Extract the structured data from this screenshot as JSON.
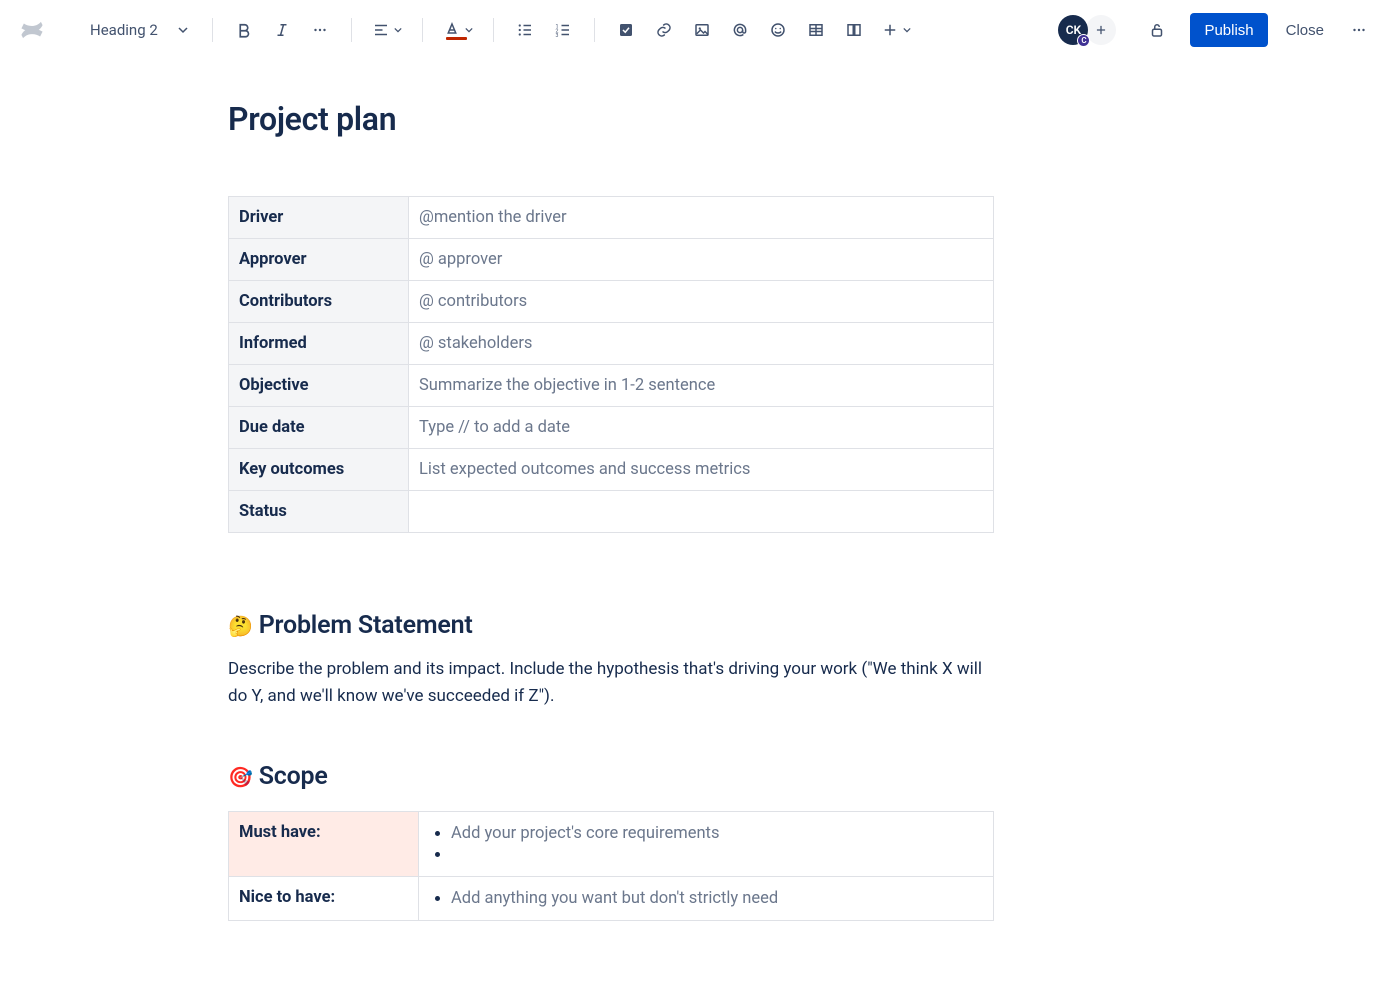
{
  "toolbar": {
    "heading_label": "Heading 2",
    "publish_label": "Publish",
    "close_label": "Close",
    "avatar_initials": "CK",
    "presence_initial": "C",
    "accent_color": "#0052CC"
  },
  "document": {
    "title": "Project plan",
    "meta_rows": [
      {
        "label": "Driver",
        "value": "@mention the driver"
      },
      {
        "label": "Approver",
        "value": "@ approver"
      },
      {
        "label": "Contributors",
        "value": "@ contributors"
      },
      {
        "label": "Informed",
        "value": "@ stakeholders"
      },
      {
        "label": "Objective",
        "value": "Summarize the objective in 1-2 sentence"
      },
      {
        "label": "Due date",
        "value": "Type // to add a date"
      },
      {
        "label": "Key outcomes",
        "value": "List expected outcomes and success metrics"
      },
      {
        "label": "Status",
        "value": ""
      }
    ],
    "problem_statement": {
      "emoji": "🤔",
      "heading": "Problem Statement",
      "body": "Describe the problem and its impact. Include the hypothesis that's driving your work (\"We think X will do Y, and we'll know we've succeeded if Z\")."
    },
    "scope": {
      "emoji": "🎯",
      "heading": "Scope",
      "rows": [
        {
          "label": "Must have:",
          "items": [
            "Add your project's core requirements",
            ""
          ]
        },
        {
          "label": "Nice to have:",
          "items": [
            "Add anything you want but don't strictly need"
          ]
        }
      ]
    }
  }
}
